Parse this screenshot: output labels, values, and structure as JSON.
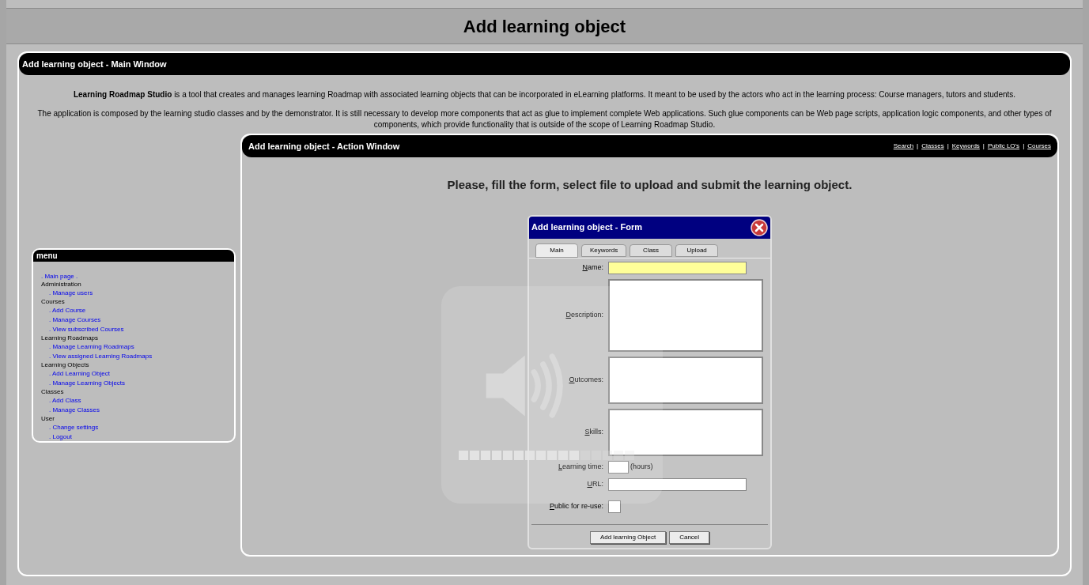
{
  "page_title": "Add learning object",
  "main_window": {
    "title": "Add learning object - Main Window",
    "intro": [
      "**Learning Roadmap Studio** is a tool that creates and manages learning Roadmap with associated learning objects that can be incorporated in eLearning platforms. It meant to be used by the actors who act in the learning process: Course managers, tutors and students.",
      "The application is composed by the learning studio classes and by the demonstrator. It is still necessary to develop more components that act as glue to implement complete Web applications. Such glue components can be Web page scripts, application logic components, and other types of components, which provide functionality that is outside of the scope of Learning Roadmap Studio."
    ]
  },
  "menu": {
    "title": "menu",
    "main_link": ". Main page .",
    "sections": [
      {
        "heading": "Administration",
        "links": [
          ". Manage users"
        ]
      },
      {
        "heading": "Courses",
        "links": [
          ". Add Course",
          ". Manage Courses",
          ". View subscribed Courses"
        ]
      },
      {
        "heading": "Learning Roadmaps",
        "links": [
          ". Manage Learning Roadmaps",
          ". View assigned Learning Roadmaps"
        ]
      },
      {
        "heading": "Learning Objects",
        "links": [
          ". Add Learning Object",
          ". Manage Learning Objects"
        ]
      },
      {
        "heading": "Classes",
        "links": [
          ". Add Class",
          ". Manage Classes"
        ]
      },
      {
        "heading": "User",
        "links": [
          ". Change settings",
          ". Logout"
        ]
      }
    ]
  },
  "action_window": {
    "title": "Add learning object - Action Window",
    "links": [
      "Search",
      "Classes",
      "Keywords",
      "Public LO's",
      "Courses"
    ],
    "separator": "|",
    "instruction": "Please, fill the form, select file to upload and submit the learning object."
  },
  "form": {
    "title": "Add learning object - Form",
    "tabs": [
      {
        "label": "Main",
        "selected": true
      },
      {
        "label": "Keywords",
        "selected": false
      },
      {
        "label": "Class",
        "selected": false
      },
      {
        "label": "Upload",
        "selected": false
      }
    ],
    "fields": [
      {
        "kind": "text",
        "label": "Name:",
        "highlighted": true
      },
      {
        "kind": "longtext",
        "label": "Description:",
        "highlighted": false
      },
      {
        "kind": "textarea",
        "label": "Outcomes:",
        "highlighted": false
      },
      {
        "kind": "textarea",
        "label": "Skills:",
        "highlighted": false
      },
      {
        "kind": "time",
        "label": "Learning time:",
        "unit": "(hours)",
        "highlighted": false
      },
      {
        "kind": "text",
        "label": "URL:",
        "highlighted": false
      },
      {
        "kind": "checkbox",
        "label": "Public for re-use:",
        "checked": false
      }
    ],
    "buttons": [
      "Add learning Object",
      "Cancel"
    ]
  },
  "volume_overlay": {
    "level": 0.69
  }
}
